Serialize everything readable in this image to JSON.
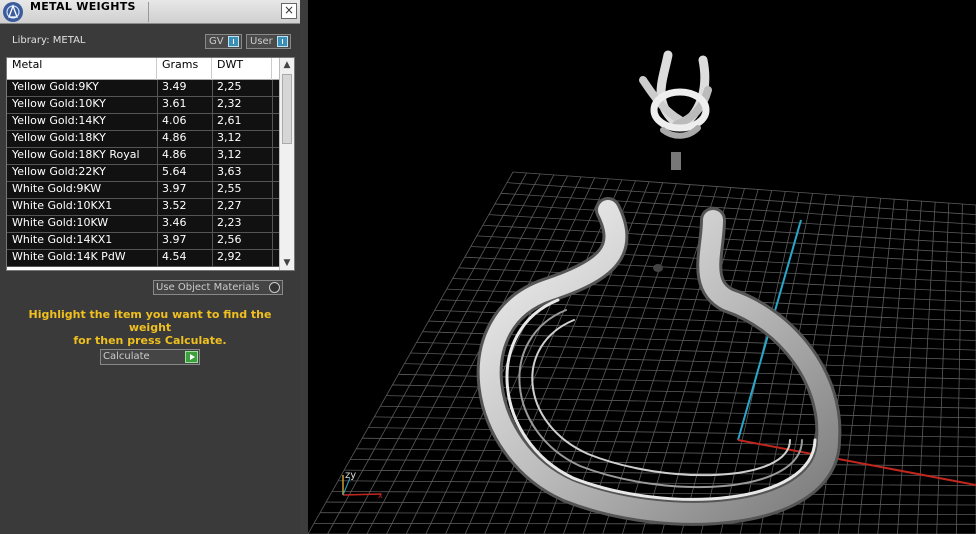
{
  "panel": {
    "title": "METAL WEIGHTS",
    "close_glyph": "×",
    "library_label": "Library: METAL",
    "gv_label": "GV",
    "user_label": "User",
    "use_object_label": "Use Object Materials",
    "instruction_line1": "Highlight the item you want to find the weight",
    "instruction_line2": "for then press Calculate.",
    "calculate_label": "Calculate",
    "instruction_color": "#f0c020"
  },
  "table": {
    "headers": {
      "metal": "Metal",
      "grams": "Grams",
      "dwt": "DWT"
    },
    "rows": [
      {
        "metal": "Yellow Gold:9KY",
        "grams": "3.49",
        "dwt": "2,25"
      },
      {
        "metal": "Yellow Gold:10KY",
        "grams": "3.61",
        "dwt": "2,32"
      },
      {
        "metal": "Yellow Gold:14KY",
        "grams": "4.06",
        "dwt": "2,61"
      },
      {
        "metal": "Yellow Gold:18KY",
        "grams": "4.86",
        "dwt": "3,12"
      },
      {
        "metal": "Yellow Gold:18KY Royal",
        "grams": "4.86",
        "dwt": "3,12"
      },
      {
        "metal": "Yellow Gold:22KY",
        "grams": "5.64",
        "dwt": "3,63"
      },
      {
        "metal": "White Gold:9KW",
        "grams": "3.97",
        "dwt": "2,55"
      },
      {
        "metal": "White Gold:10KX1",
        "grams": "3.52",
        "dwt": "2,27"
      },
      {
        "metal": "White Gold:10KW",
        "grams": "3.46",
        "dwt": "2,23"
      },
      {
        "metal": "White Gold:14KX1",
        "grams": "3.97",
        "dwt": "2,56"
      },
      {
        "metal": "White Gold:14K PdW",
        "grams": "4.54",
        "dwt": "2,92"
      }
    ]
  },
  "viewport": {
    "axis_label": "zy",
    "icons": [
      "app-logo-icon",
      "close-icon",
      "scroll-up-icon",
      "scroll-down-icon",
      "play-arrow-icon"
    ]
  }
}
